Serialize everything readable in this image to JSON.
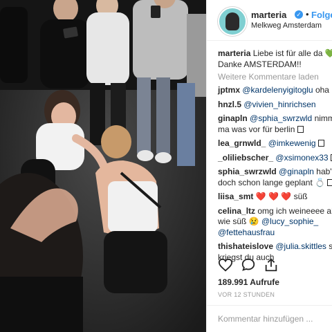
{
  "post": {
    "photo_description_icon": "concert-crowd-photo"
  },
  "header": {
    "username": "marteria",
    "verified_icon": "verified-badge-icon",
    "separator": "•",
    "follow_label": "Folgen",
    "location": "Melkweg Amsterdam"
  },
  "caption": {
    "username": "marteria",
    "text_line1": "Liebe ist für alle da",
    "text_line2": "Danke AMSTERDAM!!"
  },
  "load_more_label": "Weitere Kommentare laden",
  "comments": [
    {
      "user": "jptmx",
      "mention": "@kardelenyigitoglu",
      "text": "oha"
    },
    {
      "user": "hnzl.5",
      "mention": "@vivien_hinrichsen",
      "text": ""
    },
    {
      "user": "ginapln",
      "mention": "@sphia_swrzwld",
      "text": "nimm",
      "line2": "ma was vor für berlin"
    },
    {
      "user": "lea_grnwld_",
      "mention": "@imkewenig",
      "text": ""
    },
    {
      "user": "_oliliebscher_",
      "mention": "@xsimonex33",
      "text": ""
    },
    {
      "user": "sphia_swrzwld",
      "mention": "@ginapln",
      "text": "hab's",
      "line2": "doch schon lange geplant"
    },
    {
      "user": "liisa_smt",
      "mention": "",
      "text": "süß"
    },
    {
      "user": "celina_ltz",
      "mention": "",
      "text": "omg ich weineeee ah",
      "line2": "wie süß",
      "line2_mention": "@lucy_sophie_",
      "line3_mention": "@fettehausfrau"
    },
    {
      "user": "thishateislove",
      "mention": "@julia.skittles",
      "text": "se",
      "line2": "kriegst du auch"
    }
  ],
  "actions": {
    "like_icon": "heart-icon",
    "comment_icon": "comment-icon",
    "share_icon": "share-icon"
  },
  "likes": "189.991 Aufrufe",
  "timestamp": "VOR 12 STUNDEN",
  "comment_placeholder": "Kommentar hinzufügen ..."
}
